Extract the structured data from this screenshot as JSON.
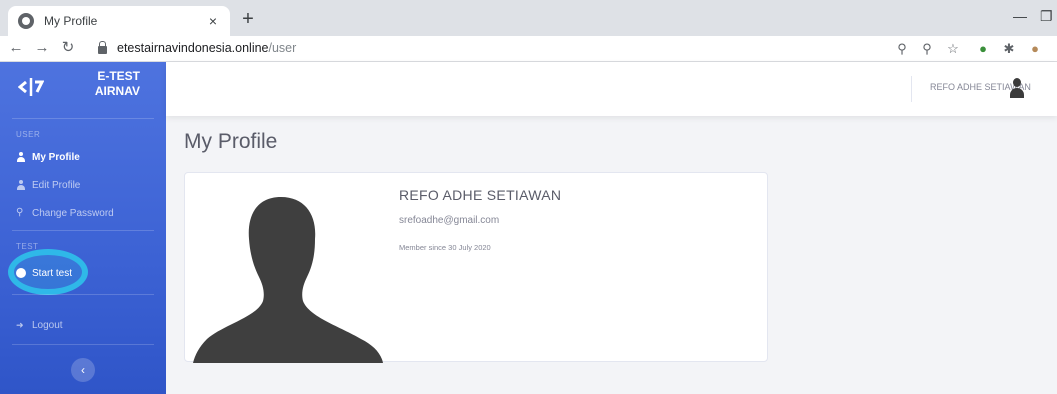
{
  "browser": {
    "tab_title": "My Profile",
    "tab_close": "×",
    "new_tab": "+",
    "url_domain": "etestairnavindonesia.online",
    "url_path": "/user",
    "icons": [
      "back-icon",
      "forward-icon",
      "reload-icon",
      "lock-icon",
      "key-icon",
      "zoom-icon",
      "star-icon",
      "extension-icon",
      "puzzle-icon",
      "profile-icon"
    ]
  },
  "brand": {
    "line1": "E-TEST",
    "line2": "AIRNAV"
  },
  "sidebar": {
    "section_user": "USER",
    "section_test": "TEST",
    "items": [
      {
        "label": "My Profile",
        "icon": "user-icon",
        "active": true
      },
      {
        "label": "Edit Profile",
        "icon": "user-edit-icon",
        "active": false
      },
      {
        "label": "Change Password",
        "icon": "key-icon",
        "active": false
      },
      {
        "label": "Start test",
        "icon": "circle-icon",
        "active": false
      },
      {
        "label": "Logout",
        "icon": "logout-icon",
        "active": false
      }
    ],
    "toggle": "‹"
  },
  "topbar": {
    "username": "REFO ADHE SETIAWAN"
  },
  "main": {
    "page_title": "My Profile",
    "profile": {
      "name": "REFO ADHE SETIAWAN",
      "email": "srefoadhe@gmail.com",
      "member_since": "Member since 30 July 2020"
    }
  },
  "colors": {
    "sidebar": "#4e73df",
    "highlight": "#2fb8e8",
    "background": "#f3f4f7"
  }
}
